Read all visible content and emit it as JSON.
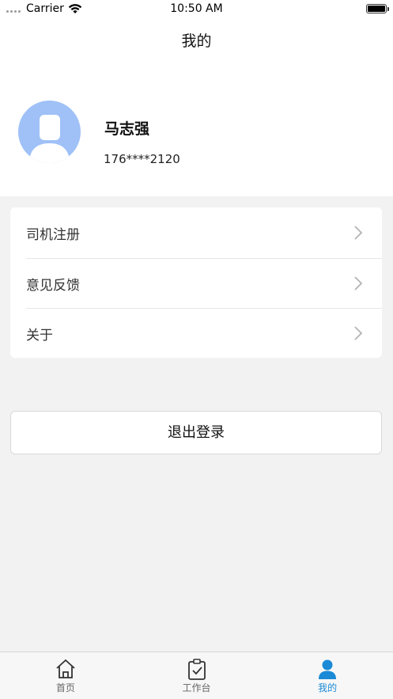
{
  "status_bar": {
    "carrier": "Carrier",
    "time": "10:50 AM"
  },
  "nav": {
    "title": "我的"
  },
  "profile": {
    "name": "马志强",
    "phone": "176****2120"
  },
  "menu": {
    "items": [
      {
        "label": "司机注册"
      },
      {
        "label": "意见反馈"
      },
      {
        "label": "关于"
      }
    ]
  },
  "logout": {
    "label": "退出登录"
  },
  "tab_bar": {
    "tabs": [
      {
        "label": "首页",
        "icon": "home-icon",
        "active": false
      },
      {
        "label": "工作台",
        "icon": "clipboard-check-icon",
        "active": false
      },
      {
        "label": "我的",
        "icon": "user-icon",
        "active": true
      }
    ],
    "active_color": "#1a8ad6",
    "inactive_color": "#666666"
  },
  "colors": {
    "avatar_bg": "#9fc1f7",
    "page_bg": "#f2f2f2"
  }
}
